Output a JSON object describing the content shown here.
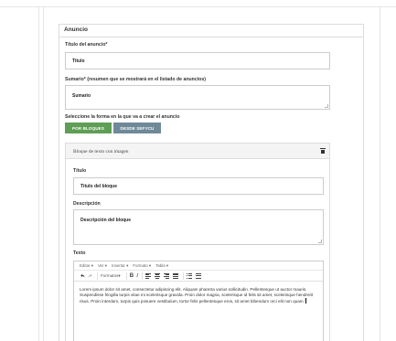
{
  "panel": {
    "title": "Anuncio"
  },
  "fields": {
    "titulo_label": "Título del anuncio*",
    "titulo_value": "Titulo",
    "sumario_label": "Sumario* (resumen que se mostrará en el listado de anuncios)",
    "sumario_value": "Sumario",
    "forma_label": "Seleccione la forma en la que va a crear el anuncio"
  },
  "buttons": {
    "bloques": "POR BLOQUES",
    "sefycu": "DESDE SEFYCU"
  },
  "block": {
    "title": "Bloque de texto con imagen",
    "titulo_label": "Título",
    "titulo_value": "Título del bloque",
    "descripcion_label": "Descripción",
    "descripcion_value": "Descripción del bloque",
    "texto_label": "Texto"
  },
  "editor": {
    "menus": [
      "Editar",
      "Ver",
      "Insertar",
      "Formato",
      "Tabla"
    ],
    "formats_label": "Formatos",
    "bold_label": "B",
    "italic_label": "I",
    "content": "Lorem ipsum dolor sit amet, consectetur adipiscing elit. Aliquam pharetra varius sollicitudin. Pellentesque ut auctor mauris. Suspendisse fringilla turpis vitae mi scelerisque gravida. Proin dolor magna, scelerisque id felis sit amet, scelerisque hendrerit risus. Proin interdum, turpis quis posuere vestibulum, tortor felis pellentesque eros, sit amet bibendum orci elit non quam."
  },
  "icons": {
    "delete": "trash-icon",
    "undo": "undo-icon",
    "redo": "redo-icon",
    "dropdown": "caret-down-icon",
    "align_left": "align-left-icon",
    "align_center": "align-center-icon",
    "align_right": "align-right-icon",
    "align_justify": "align-justify-icon",
    "bullet_list": "bullet-list-icon",
    "numbered_list": "numbered-list-icon"
  },
  "colors": {
    "bloques_button": "#5f9e55",
    "sefycu_button": "#6f8998",
    "border": "#dcdcdc"
  }
}
